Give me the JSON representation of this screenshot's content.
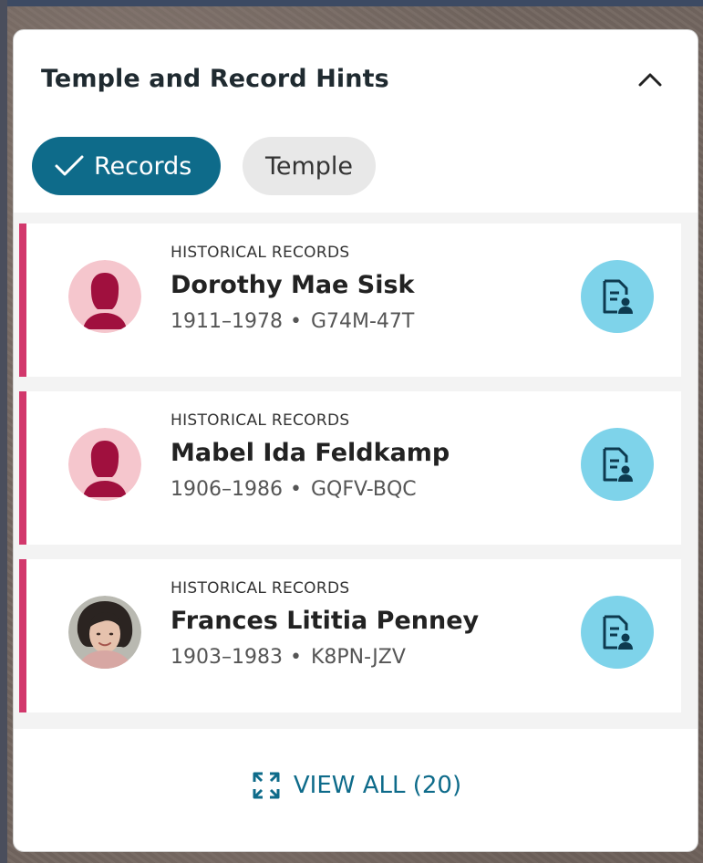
{
  "panel": {
    "title": "Temple and Record Hints",
    "collapse_icon": "chevron-up-icon"
  },
  "filters": {
    "records_label": "Records",
    "temple_label": "Temple",
    "selected": "Records"
  },
  "hints": [
    {
      "kind": "HISTORICAL RECORDS",
      "name": "Dorothy Mae Sisk",
      "years": "1911–1978",
      "id": "G74M-47T",
      "avatar": "female-silhouette-icon"
    },
    {
      "kind": "HISTORICAL RECORDS",
      "name": "Mabel Ida Feldkamp",
      "years": "1906–1986",
      "id": "GQFV-BQC",
      "avatar": "female-silhouette-icon"
    },
    {
      "kind": "HISTORICAL RECORDS",
      "name": "Frances Lititia Penney",
      "years": "1903–1983",
      "id": "K8PN-JZV",
      "avatar": "photo"
    }
  ],
  "footer": {
    "view_all_label": "VIEW ALL (20)"
  },
  "colors": {
    "accent": "#0e6b8a",
    "hint_bar": "#d2386c",
    "record_button": "#7ed3ea",
    "female_avatar_bg": "#f5c6cd",
    "female_avatar_fg": "#a0103e"
  },
  "separator": "•"
}
